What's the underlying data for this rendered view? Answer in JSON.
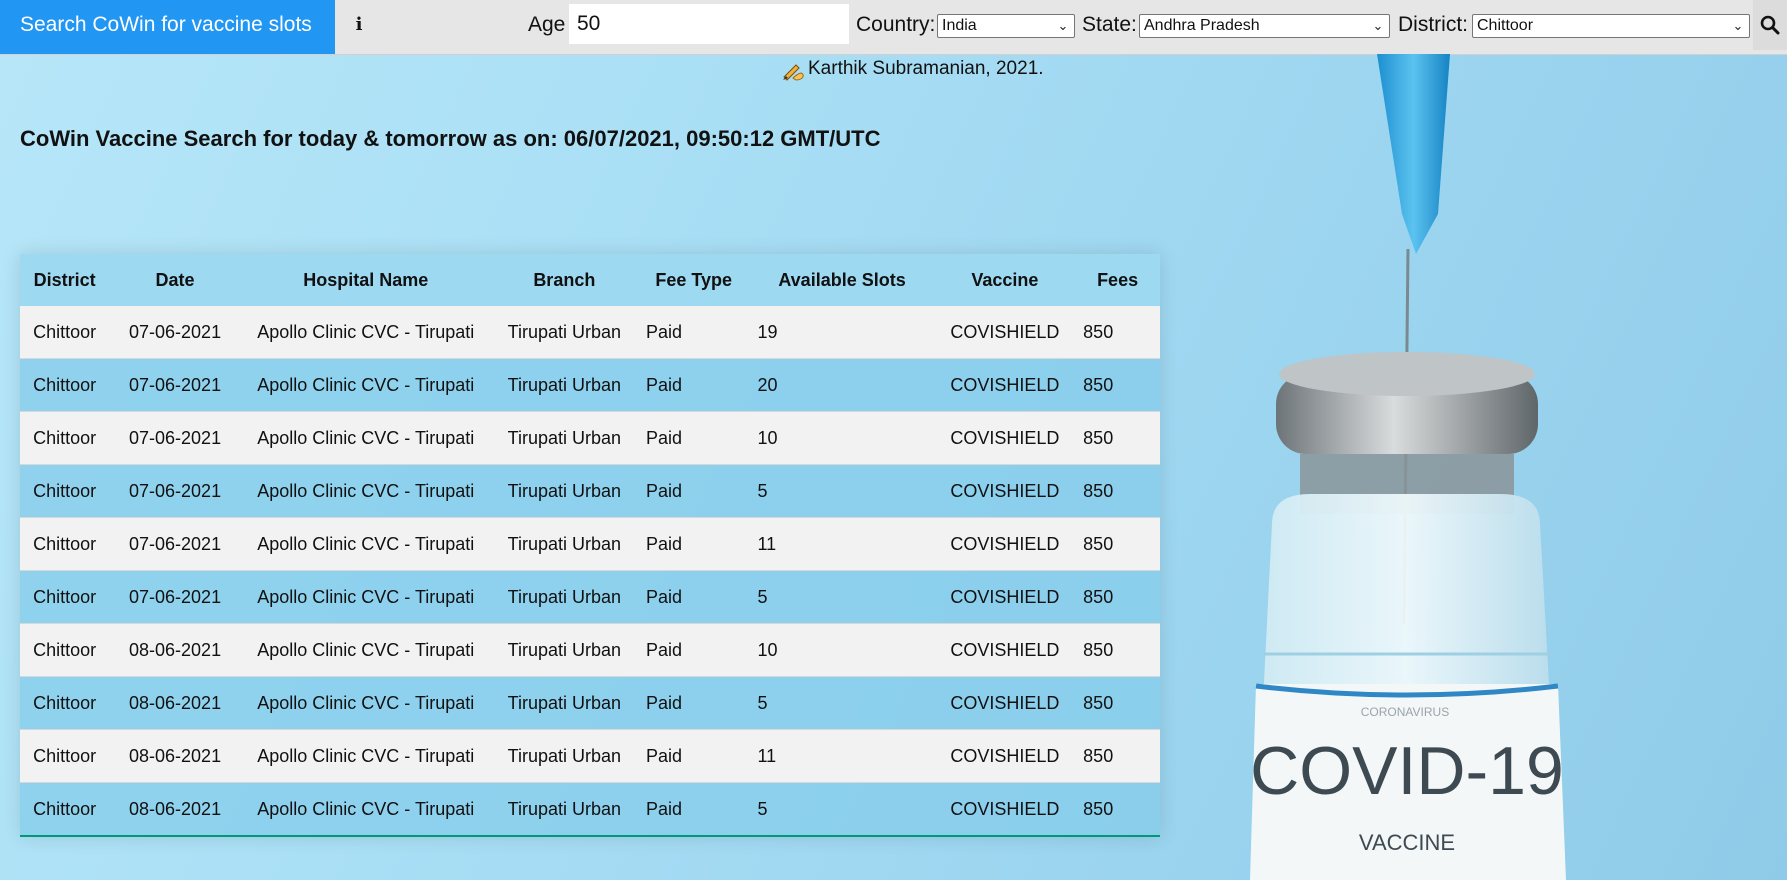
{
  "topbar": {
    "brand": "Search CoWin for vaccine slots",
    "info_icon": "info-icon",
    "age_label": "Age",
    "age_value": "50",
    "country_label": "Country:",
    "country_value": "India",
    "state_label": "State:",
    "state_value": "Andhra Pradesh",
    "district_label": "District:",
    "district_value": "Chittoor",
    "search_icon": "search-icon"
  },
  "author": {
    "icon": "writing-hand-icon",
    "text": "Karthik Subramanian, 2021."
  },
  "heading": "CoWin Vaccine Search for today & tomorrow as on: 06/07/2021, 09:50:12 GMT/UTC",
  "table": {
    "columns": [
      "District",
      "Date",
      "Hospital Name",
      "Branch",
      "Fee Type",
      "Available Slots",
      "Vaccine",
      "Fees"
    ],
    "rows": [
      [
        "Chittoor",
        "07-06-2021",
        "Apollo Clinic CVC - Tirupati",
        "Tirupati Urban",
        "Paid",
        "19",
        "COVISHIELD",
        "850"
      ],
      [
        "Chittoor",
        "07-06-2021",
        "Apollo Clinic CVC - Tirupati",
        "Tirupati Urban",
        "Paid",
        "20",
        "COVISHIELD",
        "850"
      ],
      [
        "Chittoor",
        "07-06-2021",
        "Apollo Clinic CVC - Tirupati",
        "Tirupati Urban",
        "Paid",
        "10",
        "COVISHIELD",
        "850"
      ],
      [
        "Chittoor",
        "07-06-2021",
        "Apollo Clinic CVC - Tirupati",
        "Tirupati Urban",
        "Paid",
        "5",
        "COVISHIELD",
        "850"
      ],
      [
        "Chittoor",
        "07-06-2021",
        "Apollo Clinic CVC - Tirupati",
        "Tirupati Urban",
        "Paid",
        "11",
        "COVISHIELD",
        "850"
      ],
      [
        "Chittoor",
        "07-06-2021",
        "Apollo Clinic CVC - Tirupati",
        "Tirupati Urban",
        "Paid",
        "5",
        "COVISHIELD",
        "850"
      ],
      [
        "Chittoor",
        "08-06-2021",
        "Apollo Clinic CVC - Tirupati",
        "Tirupati Urban",
        "Paid",
        "10",
        "COVISHIELD",
        "850"
      ],
      [
        "Chittoor",
        "08-06-2021",
        "Apollo Clinic CVC - Tirupati",
        "Tirupati Urban",
        "Paid",
        "5",
        "COVISHIELD",
        "850"
      ],
      [
        "Chittoor",
        "08-06-2021",
        "Apollo Clinic CVC - Tirupati",
        "Tirupati Urban",
        "Paid",
        "11",
        "COVISHIELD",
        "850"
      ],
      [
        "Chittoor",
        "08-06-2021",
        "Apollo Clinic CVC - Tirupati",
        "Tirupati Urban",
        "Paid",
        "5",
        "COVISHIELD",
        "850"
      ]
    ]
  },
  "background": {
    "vial_label_title": "COVID-19",
    "vial_label_sub": "VACCINE",
    "vial_label_top": "CORONAVIRUS"
  },
  "colors": {
    "brand_bg": "#2196f3",
    "topbar_bg": "#e6e6e6",
    "row_odd": "#f2f2f2",
    "row_even": "#84ccebbf",
    "table_bottom_border": "#009879"
  }
}
